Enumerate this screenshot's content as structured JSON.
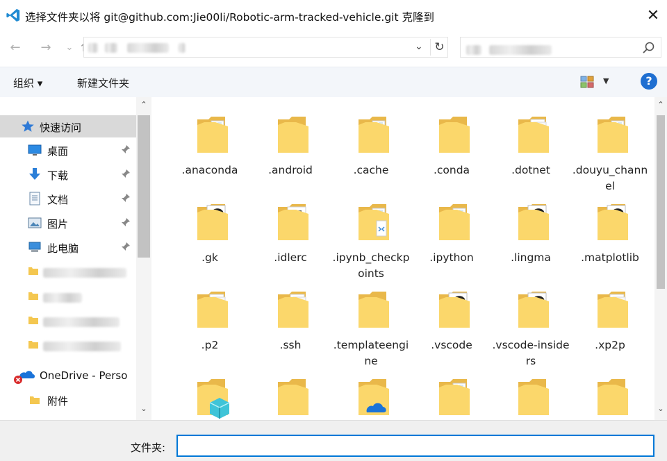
{
  "window": {
    "title": "选择文件夹以将 git@github.com:Jie00li/Robotic-arm-tracked-vehicle.git 克隆到",
    "close_glyph": "✕"
  },
  "navigation": {
    "back_glyph": "←",
    "forward_glyph": "→",
    "recent_glyph": "⌄",
    "up_glyph": "↑",
    "address_dropdown_glyph": "⌄",
    "refresh_glyph": "↻"
  },
  "search": {
    "placeholder": "",
    "icon": "search-icon"
  },
  "toolbar": {
    "organize_label": "组织 ▾",
    "new_folder_label": "新建文件夹",
    "view_dropdown_glyph": "▼",
    "help_label": "?"
  },
  "sidebar": {
    "up_arrow": "⌃",
    "down_arrow": "⌄",
    "items": [
      {
        "label": "快速访问",
        "icon": "star-icon"
      },
      {
        "label": "桌面",
        "icon": "desktop-icon"
      },
      {
        "label": "下载",
        "icon": "download-icon"
      },
      {
        "label": "文档",
        "icon": "document-icon"
      },
      {
        "label": "图片",
        "icon": "pictures-icon"
      },
      {
        "label": "此电脑",
        "icon": "computer-icon"
      },
      {
        "label": "OneDrive - Perso",
        "icon": "onedrive-icon"
      },
      {
        "label": "附件",
        "icon": "folder-icon"
      }
    ]
  },
  "files": [
    {
      "name": ".anaconda",
      "icon": "folder-doc-icon"
    },
    {
      "name": ".android",
      "icon": "folder-icon"
    },
    {
      "name": ".cache",
      "icon": "folder-doc-icon"
    },
    {
      "name": ".conda",
      "icon": "folder-icon"
    },
    {
      "name": ".dotnet",
      "icon": "folder-paper-icon"
    },
    {
      "name": ".douyu_channel",
      "icon": "folder-doc-icon"
    },
    {
      "name": ".gk",
      "icon": "folder-music-icon"
    },
    {
      "name": ".idlerc",
      "icon": "folder-text-icon"
    },
    {
      "name": ".ipynb_checkpoints",
      "icon": "folder-code-icon"
    },
    {
      "name": ".ipython",
      "icon": "folder-doc-icon"
    },
    {
      "name": ".lingma",
      "icon": "folder-music-icon"
    },
    {
      "name": ".matplotlib",
      "icon": "folder-music-icon"
    },
    {
      "name": ".p2",
      "icon": "folder-paper-icon"
    },
    {
      "name": ".ssh",
      "icon": "folder-paper-icon"
    },
    {
      "name": ".templateengine",
      "icon": "folder-icon"
    },
    {
      "name": ".vscode",
      "icon": "folder-music-icon"
    },
    {
      "name": ".vscode-insiders",
      "icon": "folder-music-icon"
    },
    {
      "name": ".xp2p",
      "icon": "folder-paper-icon"
    },
    {
      "name": "",
      "icon": "folder-3d-icon"
    },
    {
      "name": "",
      "icon": "folder-icon"
    },
    {
      "name": "",
      "icon": "folder-onedrive-icon"
    },
    {
      "name": "",
      "icon": "folder-doc-icon"
    },
    {
      "name": "",
      "icon": "folder-icon"
    },
    {
      "name": "",
      "icon": "folder-icon"
    }
  ],
  "content_scroll": {
    "up_arrow": "⌃",
    "down_arrow": "⌄"
  },
  "bottom": {
    "folder_label": "文件夹:",
    "folder_value": ""
  },
  "colors": {
    "folder_back": "#e9b84a",
    "folder_front": "#fbd76b",
    "accent": "#0078d7",
    "help_blue": "#1f6fd1"
  }
}
